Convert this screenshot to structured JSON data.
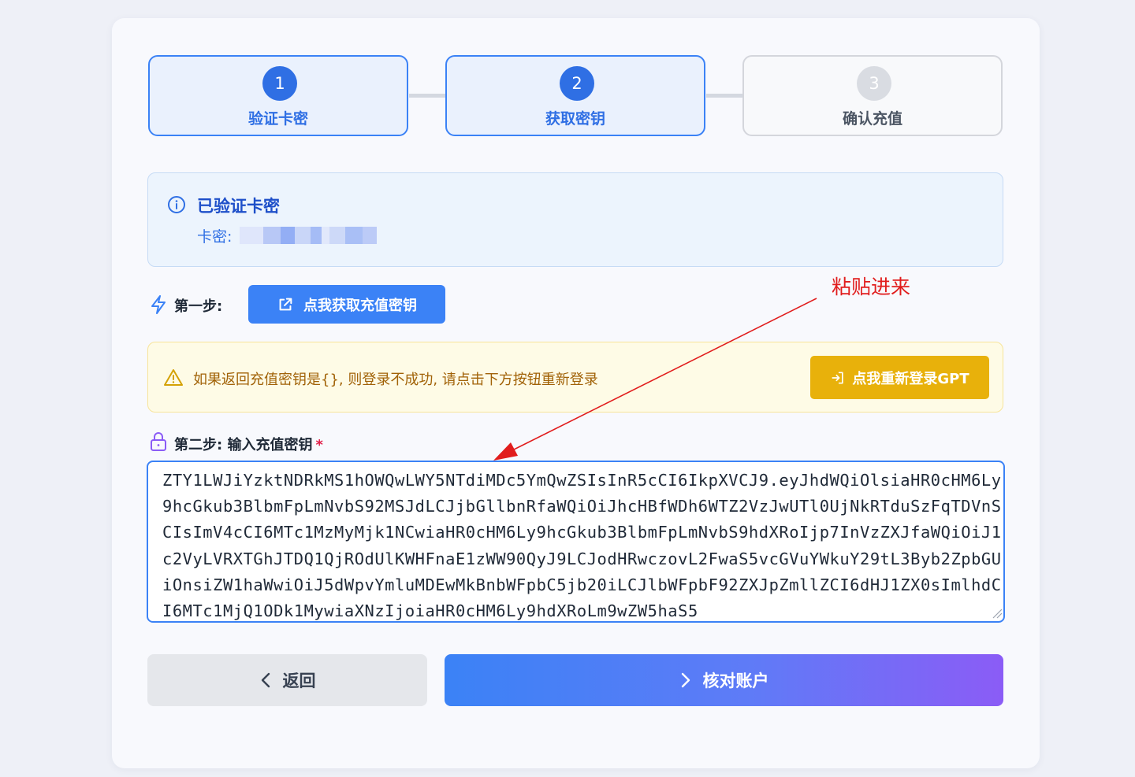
{
  "steps": [
    {
      "number": "1",
      "label": "验证卡密",
      "state": "done"
    },
    {
      "number": "2",
      "label": "获取密钥",
      "state": "active"
    },
    {
      "number": "3",
      "label": "确认充值",
      "state": "pending"
    }
  ],
  "verified": {
    "title": "已验证卡密",
    "card_label": "卡密:",
    "icon": "info-icon"
  },
  "step1": {
    "label": "第一步:",
    "button_label": "点我获取充值密钥",
    "icon": "lightning-icon",
    "button_icon": "external-link-icon"
  },
  "annotation": {
    "text": "粘贴进来",
    "color": "#e11d1d"
  },
  "warning": {
    "text": "如果返回充值密钥是{}, 则登录不成功, 请点击下方按钮重新登录",
    "button_label": "点我重新登录GPT",
    "icon": "warning-icon",
    "button_icon": "login-icon"
  },
  "step2": {
    "label": "第二步: 输入充值密钥",
    "required_mark": "*",
    "icon": "lock-icon"
  },
  "token_input": {
    "value": "ZTY1LWJiYzktNDRkMS1hOWQwLWY5NTdiMDc5YmQwZSIsInR5cCI6IkpXVCJ9.eyJhdWQiOlsiaHR0cHM6Ly9hcGkub3BlbmFpLmNvbS92MSJdLCJjbGllbnRfaWQiOiJhcHBfWDh6WTZ2VzJwUTl0UjNkRTduSzFqTDVnSCIsImV4cCI6MTc1MzMyMjk1NCwiaHR0cHM6Ly9hcGkub3BlbmFpLmNvbS9hdXRoIjp7InVzZXJfaWQiOiJ1c2VyLVRXTGhJTDQ1QjROdUlKWHFnaE1zWW90QyJ9LCJodHRwczovL2FwaS5vcGVuYWkuY29tL3Byb2ZpbGUiOnsiZW1haWwiOiJ5dWpvYmluMDEwMkBnbWFpbC5jb20iLCJlbWFpbF92ZXJpZmllZCI6dHJ1ZX0sImlhdCI6MTc1MjQ1ODk1MywiaXNzIjoiaHR0cHM6Ly9hdXRoLm9wZW5haS5"
  },
  "buttons": {
    "back_label": "返回",
    "verify_label": "核对账户",
    "back_icon": "chevron-left-icon",
    "verify_icon": "chevron-right-icon"
  },
  "colors": {
    "primary": "#3b82f6",
    "warning": "#e8b10b",
    "accent_purple": "#8b5cf6"
  }
}
